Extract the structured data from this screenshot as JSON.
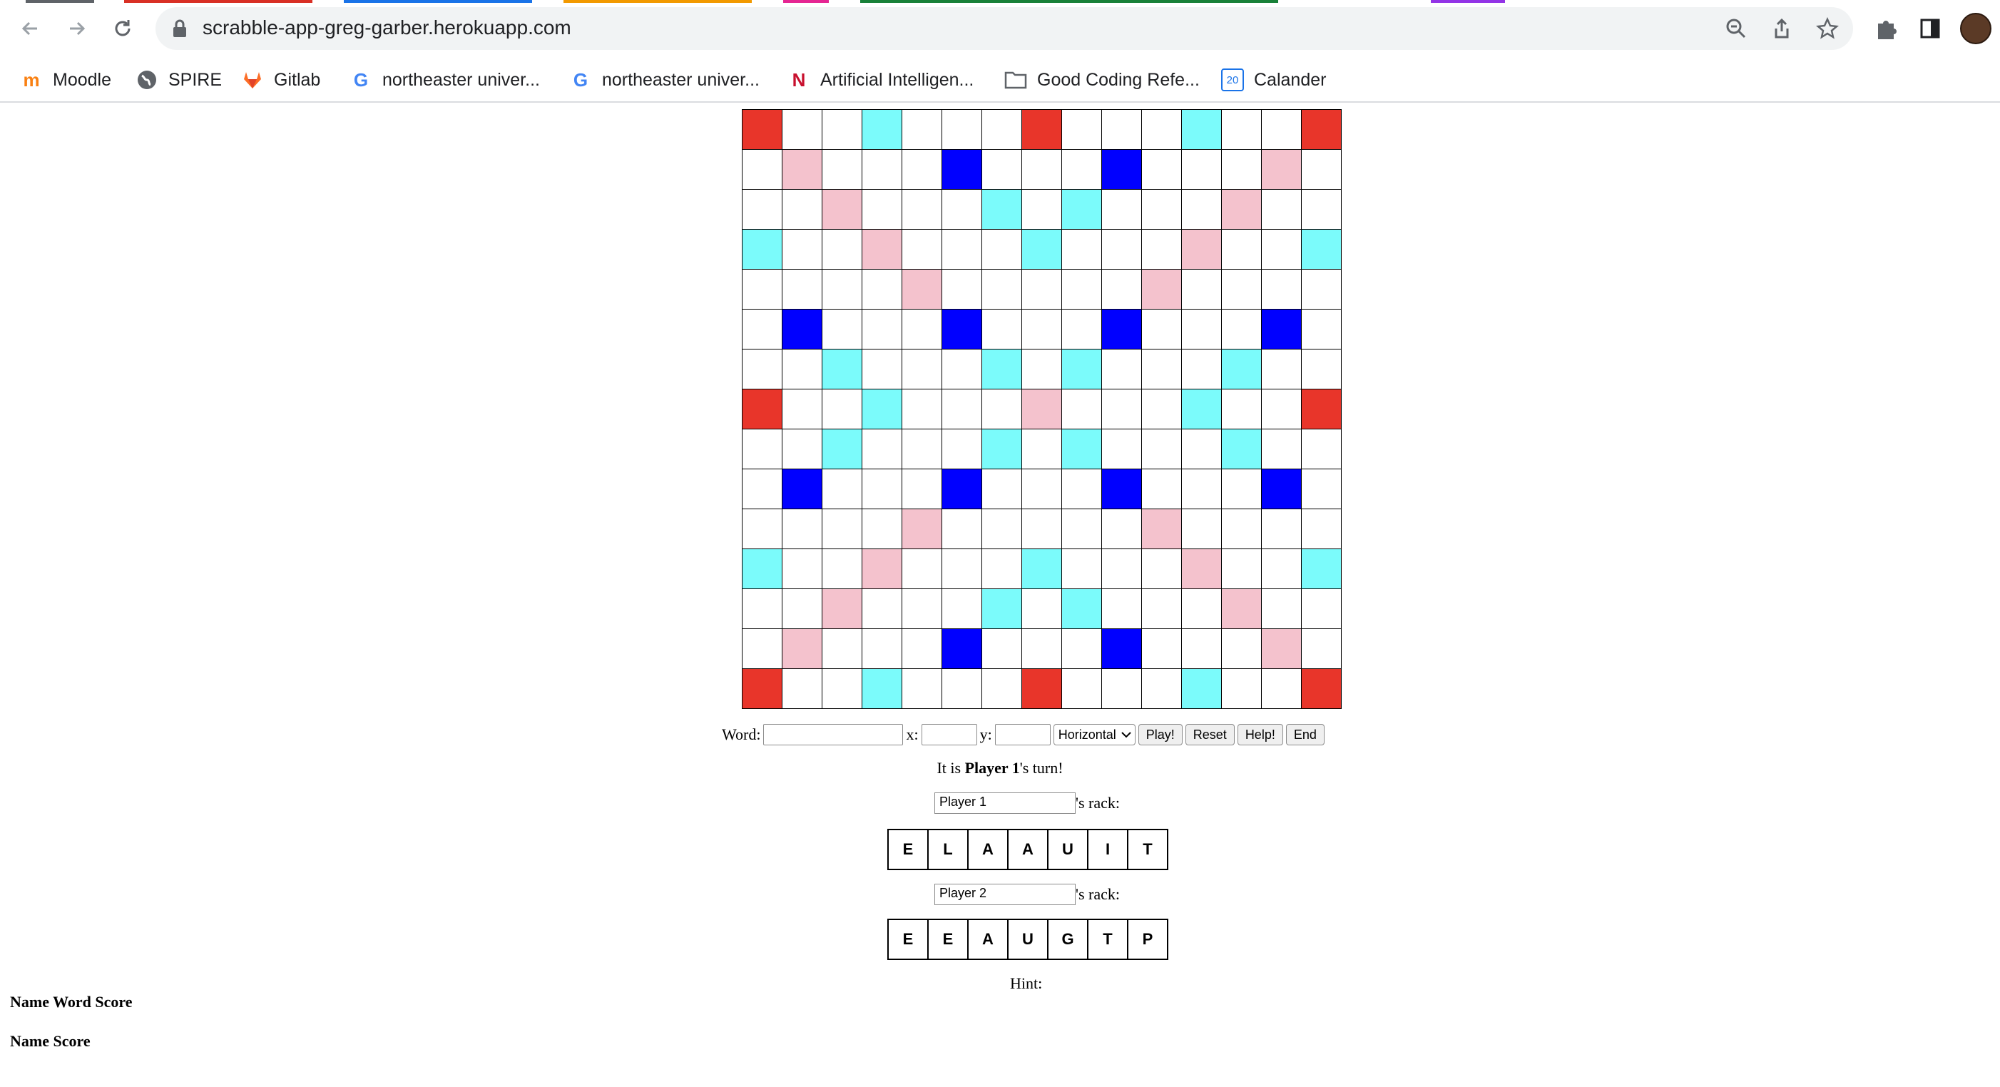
{
  "browser": {
    "url": "scrabble-app-greg-garber.herokuapp.com",
    "tab_colors": [
      "#5f6368",
      "#d93025",
      "#1a73e8",
      "#f29900",
      "#e52592",
      "#188038",
      "#9334e6"
    ],
    "bookmarks": [
      {
        "label": "Moodle",
        "icon": "moodle-icon",
        "color": "#f98012"
      },
      {
        "label": "SPIRE",
        "icon": "globe-icon",
        "color": "#5f6368"
      },
      {
        "label": "Gitlab",
        "icon": "gitlab-icon",
        "color": "#fc6d26"
      },
      {
        "label": "northeaster univer...",
        "icon": "google-icon",
        "color": "#4285f4"
      },
      {
        "label": "northeaster univer...",
        "icon": "google-icon",
        "color": "#4285f4"
      },
      {
        "label": "Artificial Intelligen...",
        "icon": "northeastern-icon",
        "color": "#c8102e"
      },
      {
        "label": "Good Coding Refe...",
        "icon": "folder-icon",
        "color": "#5f6368"
      },
      {
        "label": "Calander",
        "icon": "calendar-icon",
        "color": "#1a73e8",
        "icon_text": "20"
      }
    ]
  },
  "colors": {
    "T": "#e8352a",
    "D": "#f4c2cd",
    "L": "#7bfbfb",
    "B": "#0000ff",
    ".": "#ffffff"
  },
  "board": [
    "T..L...T...L..T",
    ".D...B...B...D.",
    "..D...L.L...D..",
    "L..D...L...D..L",
    "....D.....D....",
    ".B...B...B...B.",
    "..L...L.L...L..",
    "T..L...D...L..T",
    "..L...L.L...L..",
    ".B...B...B...B.",
    "....D.....D....",
    "L..D...L...D..L",
    "..D...L.L...D..",
    ".D...B...B...D.",
    "T..L...T...L..T"
  ],
  "controls": {
    "word_label": "Word:",
    "word_value": "",
    "x_label": "x:",
    "x_value": "",
    "y_label": "y:",
    "y_value": "",
    "direction": "Horizontal",
    "play": "Play!",
    "reset": "Reset",
    "help": "Help!",
    "end": "End"
  },
  "turn": {
    "prefix": "It is ",
    "player": "Player 1",
    "suffix": "'s turn!"
  },
  "players": [
    {
      "name": "Player 1",
      "rack_suffix": "'s rack:",
      "tiles": [
        "E",
        "L",
        "A",
        "A",
        "U",
        "I",
        "T"
      ]
    },
    {
      "name": "Player 2",
      "rack_suffix": "'s rack:",
      "tiles": [
        "E",
        "E",
        "A",
        "U",
        "G",
        "T",
        "P"
      ]
    }
  ],
  "hint_label": "Hint:",
  "word_table_header": "Name Word Score",
  "score_table_header": "Name Score"
}
